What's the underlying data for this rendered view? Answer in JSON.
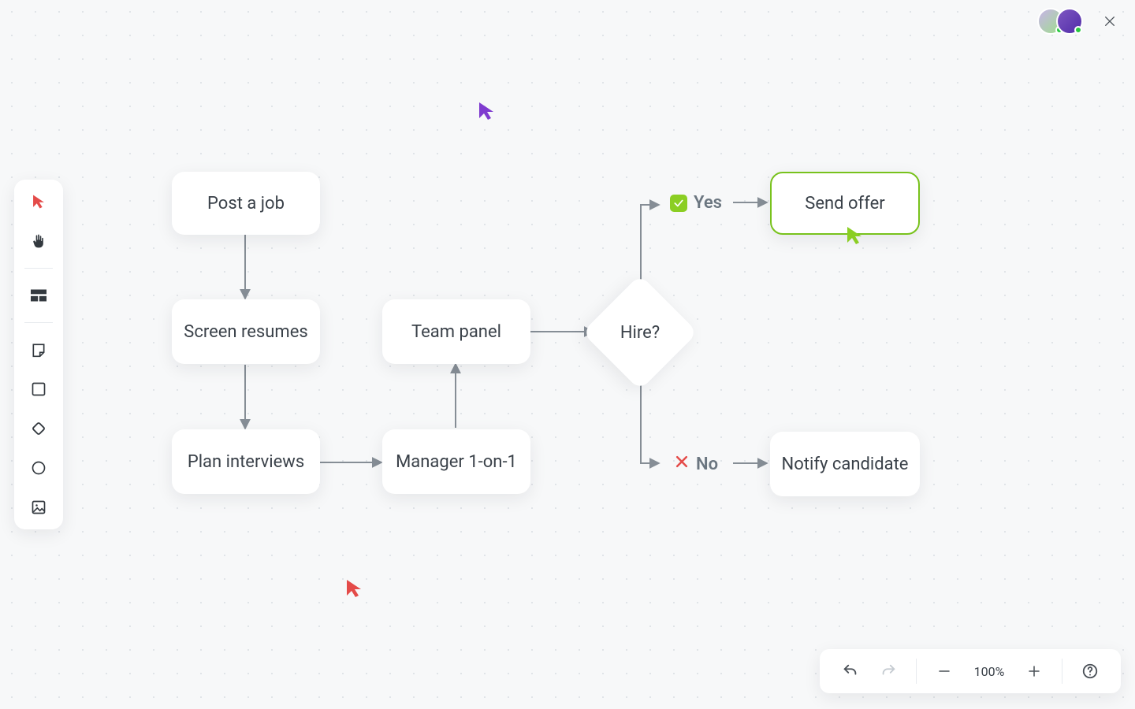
{
  "toolbar": {
    "tools": [
      "pointer",
      "hand",
      "section",
      "sticky",
      "rectangle",
      "diamond",
      "circle",
      "image"
    ]
  },
  "flow": {
    "nodes": {
      "post_job": "Post a job",
      "screen_resumes": "Screen resumes",
      "plan_interviews": "Plan interviews",
      "manager_1on1": "Manager 1-on-1",
      "team_panel": "Team panel",
      "hire": "Hire?",
      "send_offer": "Send offer",
      "notify_candidate": "Notify candidate"
    },
    "branches": {
      "yes": "Yes",
      "no": "No"
    },
    "selected": "send_offer"
  },
  "collaborators": {
    "avatars": [
      {
        "name": "collaborator-1",
        "online": true
      },
      {
        "name": "collaborator-2",
        "online": true
      }
    ],
    "cursors": [
      {
        "owner": "collaborator-1",
        "color": "#7f3bcf"
      },
      {
        "owner": "collaborator-2",
        "color": "#8bce23"
      },
      {
        "owner": "collaborator-3",
        "color": "#e44b49"
      }
    ]
  },
  "bottombar": {
    "zoom_label": "100%",
    "undo_enabled": true,
    "redo_enabled": false
  },
  "chart_data": {
    "type": "flowchart",
    "nodes": [
      {
        "id": "post_job",
        "label": "Post a job",
        "kind": "process"
      },
      {
        "id": "screen_resumes",
        "label": "Screen resumes",
        "kind": "process"
      },
      {
        "id": "plan_interviews",
        "label": "Plan interviews",
        "kind": "process"
      },
      {
        "id": "manager_1on1",
        "label": "Manager 1-on-1",
        "kind": "process"
      },
      {
        "id": "team_panel",
        "label": "Team panel",
        "kind": "process"
      },
      {
        "id": "hire",
        "label": "Hire?",
        "kind": "decision"
      },
      {
        "id": "send_offer",
        "label": "Send offer",
        "kind": "process",
        "selected": true
      },
      {
        "id": "notify_candidate",
        "label": "Notify candidate",
        "kind": "process"
      }
    ],
    "edges": [
      {
        "from": "post_job",
        "to": "screen_resumes"
      },
      {
        "from": "screen_resumes",
        "to": "plan_interviews"
      },
      {
        "from": "plan_interviews",
        "to": "manager_1on1"
      },
      {
        "from": "manager_1on1",
        "to": "team_panel"
      },
      {
        "from": "team_panel",
        "to": "hire"
      },
      {
        "from": "hire",
        "to": "send_offer",
        "label": "Yes"
      },
      {
        "from": "hire",
        "to": "notify_candidate",
        "label": "No"
      }
    ]
  }
}
